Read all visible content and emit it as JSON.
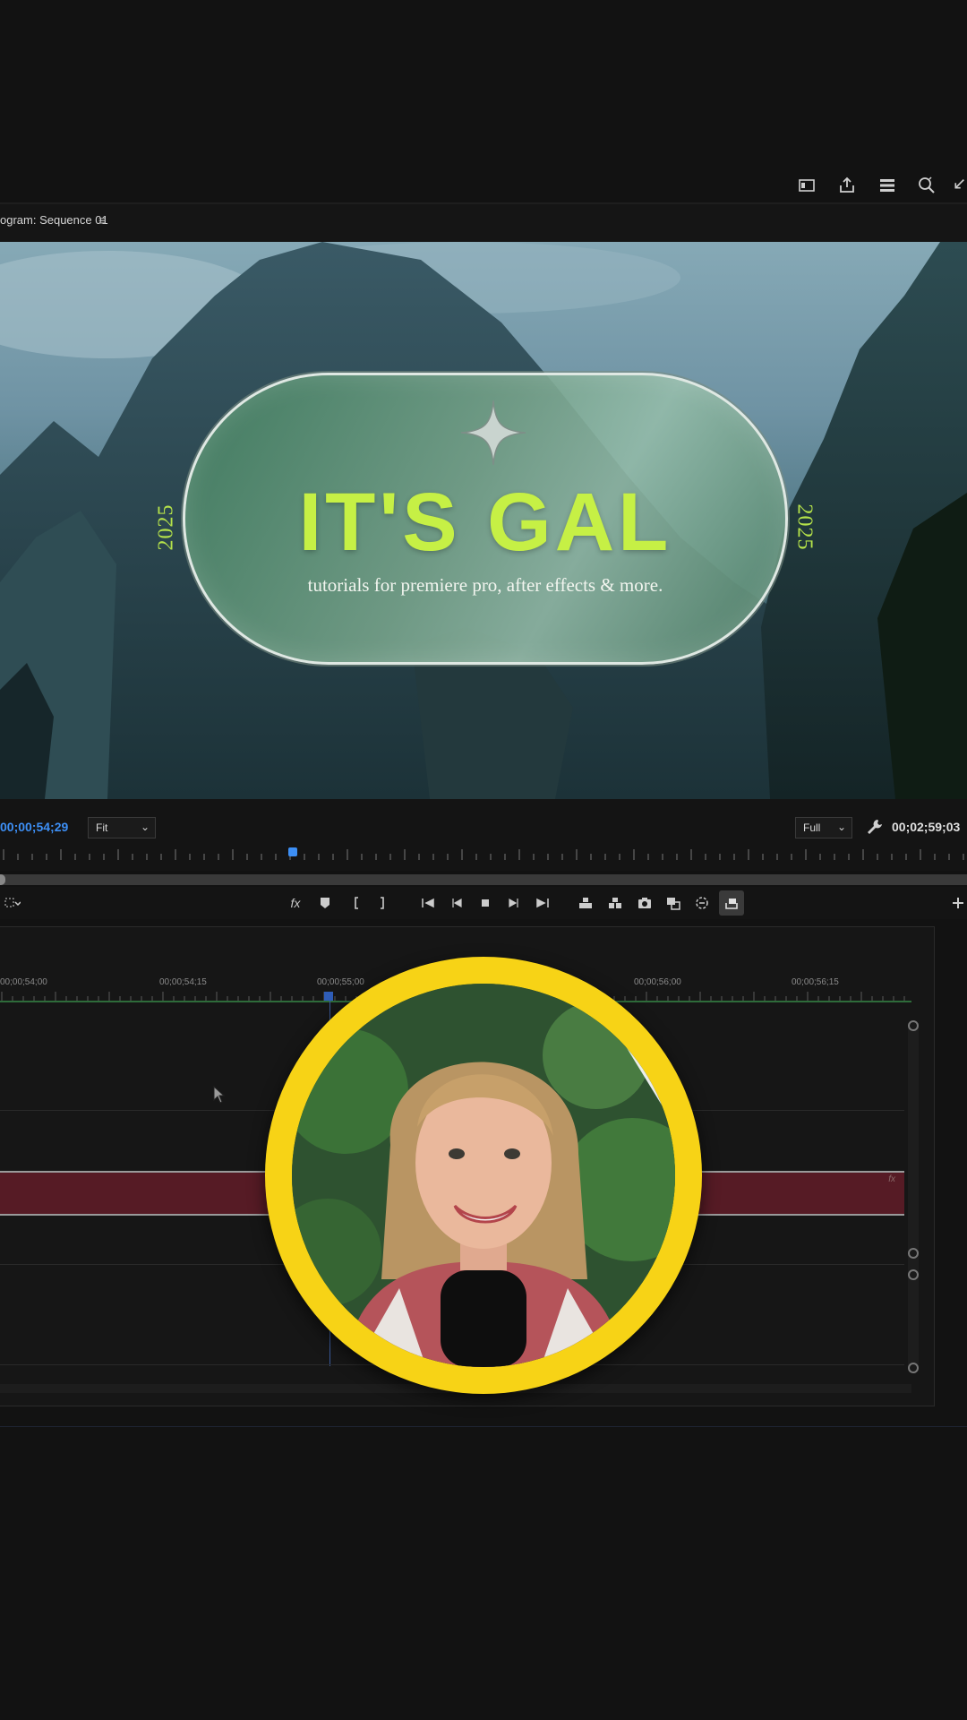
{
  "panel": {
    "title": "ogram: Sequence 01",
    "menu_glyph": "≡"
  },
  "top_toolbar": {
    "icons": [
      "panel-toggle-icon",
      "share-icon",
      "layers-icon",
      "zoom-icon",
      "collapse-icon"
    ]
  },
  "video": {
    "headline": "IT'S GAL",
    "tagline": "tutorials for premiere pro, after effects & more.",
    "year_left": "2025",
    "year_right": "2025",
    "accent_color": "#c6f045"
  },
  "monitor_controls": {
    "current_timecode": "00;00;54;29",
    "fit_label": "Fit",
    "resolution_label": "Full",
    "duration_timecode": "00;02;59;03",
    "timecode_color": "#3d8ff5"
  },
  "transport": {
    "fx_label": "fx",
    "icons": [
      "fx-icon",
      "marker-icon",
      "in-point-icon",
      "out-point-icon",
      "go-to-in-icon",
      "step-back-icon",
      "stop-icon",
      "step-forward-icon",
      "go-to-out-icon",
      "lift-icon",
      "extract-icon",
      "camera-icon",
      "compare-icon",
      "proxy-icon",
      "export-frame-icon",
      "add-icon"
    ]
  },
  "timeline": {
    "ruler_labels": [
      "00;00;54;00",
      "00;00;54;15",
      "00;00;55;00",
      "00;00;56;00",
      "00;00;56;15"
    ],
    "clip_fx": "fx",
    "clip_color": "#561b25"
  },
  "webcam": {
    "ring_color": "#f7d316"
  }
}
